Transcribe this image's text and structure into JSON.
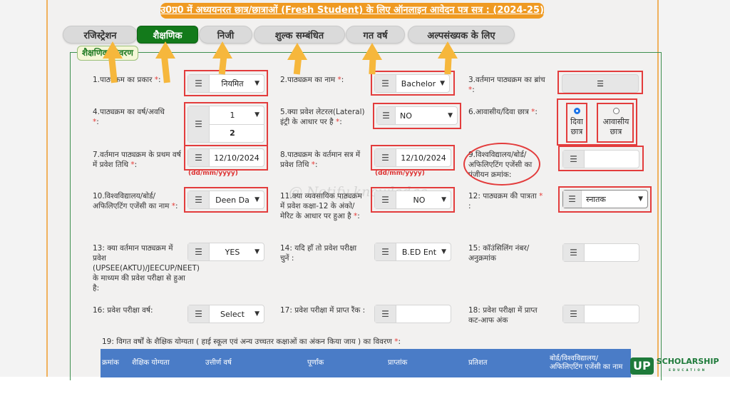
{
  "header": {
    "title": "उ0प्र0 में अध्ययनरत छात्र/छात्राओं (Fresh Student) के लिए ऑनलाइन आवेदन पत्र सत्र : (2024-25)"
  },
  "tabs": [
    {
      "label": "रजिस्ट्रेशन",
      "active": false
    },
    {
      "label": "शैक्षणिक",
      "active": true
    },
    {
      "label": "निजी",
      "active": false
    },
    {
      "label": "शुल्क सम्बंधित",
      "active": false
    },
    {
      "label": "गत वर्ष",
      "active": false
    },
    {
      "label": "अल्पसंख्यक के लिए",
      "active": false
    }
  ],
  "section": {
    "legend": "शैक्षणिक विवरण"
  },
  "required_mark": "*",
  "date_hint": "(dd/mm/yyyy)",
  "fields": {
    "f1": {
      "label": "1.पाठ्यक्रम का प्रकार",
      "suffix": ":",
      "value": "नियमित"
    },
    "f2": {
      "label": "2.पाठ्यक्रम का नाम",
      "suffix": ":",
      "value": "Bachelor"
    },
    "f3": {
      "label": "3.वर्तमान पाठ्यक्रम का ब्रांच",
      "suffix": ":",
      "value": ""
    },
    "f4": {
      "label": "4.पाठ्यक्रम का वर्ष/अवधि",
      "suffix": ":",
      "value_year": "1",
      "value_duration": "2"
    },
    "f5": {
      "label": "5.क्या प्रवेश लेटरल(Lateral) इंट्री के आधार पर है",
      "suffix": ":",
      "value": "NO"
    },
    "f6": {
      "label": "6.आवासीय/दिवा छात्र",
      "suffix": ":",
      "options": [
        {
          "label": "दिवा छात्र",
          "checked": true
        },
        {
          "label": "आवासीय छात्र",
          "checked": false
        }
      ]
    },
    "f7": {
      "label": "7.वर्तमान पाठ्यक्रम के प्रथम वर्ष में प्रवेश तिथि",
      "suffix": ":",
      "value": "12/10/2024"
    },
    "f8": {
      "label": "8.पाठ्यक्रम के वर्तमान सत्र में प्रवेश तिथि",
      "suffix": ":",
      "value": "12/10/2024"
    },
    "f9": {
      "label": "9.विश्वविद्यालय/बोर्ड/अफिलिएटिंग एजेंसी का पंजीयन क्रमांक:",
      "value": ""
    },
    "f10": {
      "label": "10.विश्वविद्यालय/बोर्ड/अफिलिएटिंग एजेंसी का नाम",
      "suffix": ":",
      "value": "Deen Da"
    },
    "f11": {
      "label": "11.क्या व्यवसायिक पाठ्यक्रम में प्रवेश कक्षा-12 के अंको/मेरिट के आधार पर हुआ है",
      "suffix": ":",
      "value": "NO"
    },
    "f12": {
      "label": "12: पाठ्यक्रम की पात्रता",
      "suffix": ":",
      "value": "स्नातक"
    },
    "f13": {
      "label": "13: क्या वर्तमान पाठ्यक्रम में प्रवेश (UPSEE(AKTU)/JEECUP/NEET) के माध्यम की प्रवेश परीक्षा से हुआ है:",
      "value": "YES"
    },
    "f14": {
      "label": "14: यदि हाँ तो प्रवेश परीक्षा चुनें :",
      "value": "B.ED Ent"
    },
    "f15": {
      "label": "15: कॉउंसिलिंग नंबर/ अनुक्रमांक",
      "value": ""
    },
    "f16": {
      "label": "16: प्रवेश परीक्षा वर्ष:",
      "value": "Select"
    },
    "f17": {
      "label": "17: प्रवेश परीक्षा में प्राप्त रैंक :",
      "value": ""
    },
    "f18": {
      "label": "18: प्रवेश परीक्षा में प्राप्त कट-आफ अंक",
      "value": ""
    },
    "f19": {
      "label": "19: विगत वर्षों के शैक्षिक योग्यता ( हाई स्कूल एवं अन्य उच्चतर कक्षाओं का अंकन किया जाय ) का विवरण",
      "suffix": ":"
    }
  },
  "table": {
    "headers": [
      "क्रमांक",
      "शैक्षिक योग्यता",
      "उत्तीर्ण वर्ष",
      "पूर्णांक",
      "प्राप्तांक",
      "प्रतिशत",
      "बोर्ड/विश्वविद्यालय/ अफिलिएटिंग एजेंसी का नाम"
    ]
  },
  "watermark": "@ Notify knowledge",
  "logo": {
    "mark": "UP",
    "name": "SCHOLARSHIP",
    "tagline": "EDUCATION"
  },
  "colors": {
    "accent_orange": "#ef9a22",
    "active_tab": "#137a1b",
    "annotation_red": "#e33c3c",
    "table_header": "#4a7cc7"
  }
}
